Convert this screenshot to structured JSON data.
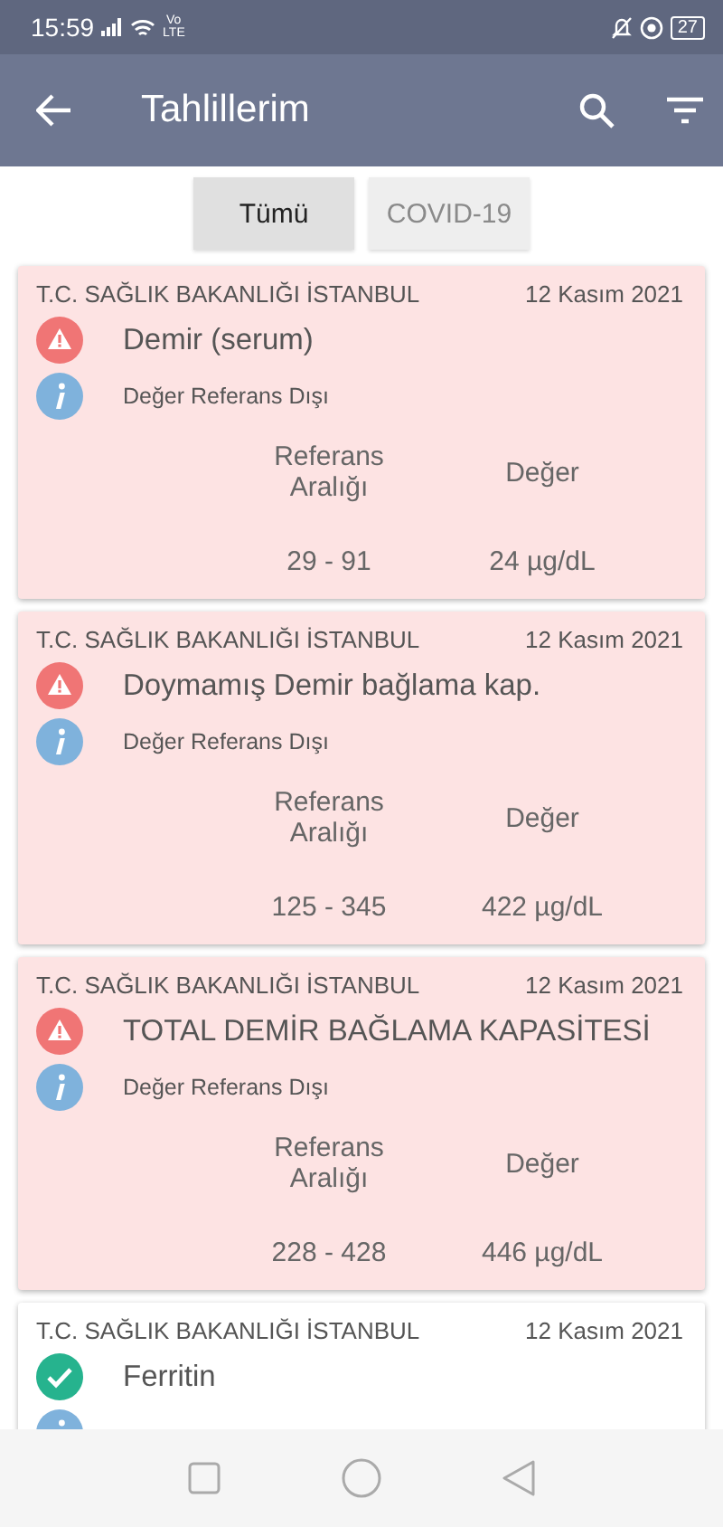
{
  "status_bar": {
    "time": "15:59",
    "network": "Vo LTE",
    "battery": "27"
  },
  "app_bar": {
    "title": "Tahlillerim"
  },
  "tabs": [
    {
      "label": "Tümü",
      "selected": true
    },
    {
      "label": "COVID-19",
      "selected": false
    }
  ],
  "results": [
    {
      "kind": "abnormal",
      "institution": "T.C. SAĞLIK BAKANLIĞI İSTANBUL",
      "date": "12 Kasım 2021",
      "name": "Demir (serum)",
      "status": "Değer Referans Dışı",
      "range_label": "Referans Aralığı",
      "value_label": "Değer",
      "range": "29 - 91",
      "value": "24 µg/dL"
    },
    {
      "kind": "abnormal",
      "institution": "T.C. SAĞLIK BAKANLIĞI İSTANBUL",
      "date": "12 Kasım 2021",
      "name": "Doymamış Demir bağlama kap.",
      "status": "Değer Referans Dışı",
      "range_label": "Referans Aralığı",
      "value_label": "Değer",
      "range": "125 - 345",
      "value": "422 µg/dL"
    },
    {
      "kind": "abnormal",
      "institution": "T.C. SAĞLIK BAKANLIĞI İSTANBUL",
      "date": "12 Kasım 2021",
      "name": "TOTAL DEMİR BAĞLAMA KAPASİTESİ",
      "status": "Değer Referans Dışı",
      "range_label": "Referans Aralığı",
      "value_label": "Değer",
      "range": "228 - 428",
      "value": "446 µg/dL"
    },
    {
      "kind": "normal",
      "institution": "T.C. SAĞLIK BAKANLIĞI İSTANBUL",
      "date": "12 Kasım 2021",
      "name": "Ferritin"
    }
  ]
}
